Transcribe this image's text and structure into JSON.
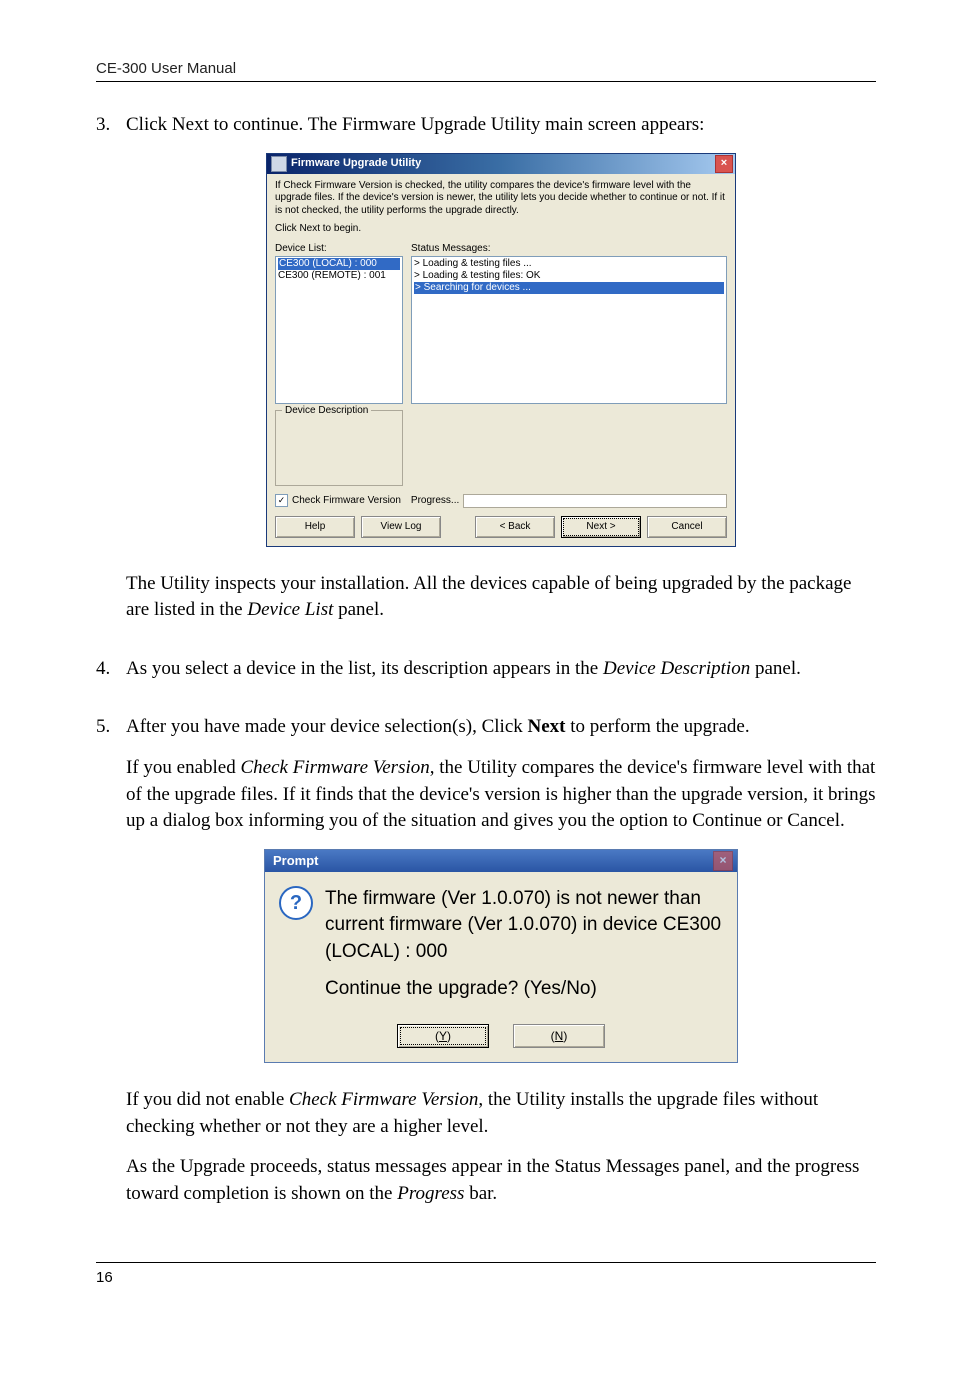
{
  "header": {
    "runhead": "CE-300 User Manual"
  },
  "items": {
    "n3": {
      "num": "3.",
      "lead": "Click Next to continue. The Firmware Upgrade Utility main screen appears:",
      "after1a": "The Utility inspects your installation. All the devices capable of being upgraded by the package are listed in the ",
      "after1b": "Device List",
      "after1c": " panel."
    },
    "n4": {
      "num": "4.",
      "a": "As you select a device in the list, its description appears in the ",
      "b": "Device Description",
      "c": " panel."
    },
    "n5": {
      "num": "5.",
      "a": "After you have made your device selection(s), Click ",
      "b": "Next",
      "c": " to perform the upgrade.",
      "p2a": "If you enabled ",
      "p2b": "Check Firmware Version",
      "p2c": ", the Utility compares the device's firmware level with that of the upgrade files. If it finds that the device's version is higher than the upgrade version, it brings up a dialog box informing you of the situation and gives you the option to Continue or Cancel.",
      "p3a": "If you did not enable ",
      "p3b": "Check Firmware Version",
      "p3c": ", the Utility installs the upgrade files without checking whether or not they are a higher level.",
      "p4a": "As the Upgrade proceeds, status messages appear in the Status Messages panel, and the progress toward completion is shown on the ",
      "p4b": "Progress",
      "p4c": " bar."
    }
  },
  "win": {
    "title": "Firmware Upgrade Utility",
    "close": "×",
    "instr": "If Check Firmware Version is checked, the utility compares the device's firmware level with the upgrade files. If the device's version is newer, the utility lets you decide whether to continue or not. If it is not checked, the utility performs the upgrade directly.",
    "click_next": "Click Next to begin.",
    "dev_list_label": "Device List:",
    "status_label": "Status Messages:",
    "dev0": "CE300 (LOCAL) : 000",
    "dev1": "CE300 (REMOTE) : 001",
    "sm0": "> Loading & testing files ...",
    "sm1": "> Loading & testing files: OK",
    "sm2": "> Searching for devices ...",
    "desc_legend": "Device Description",
    "check_fw": "Check Firmware Version",
    "progress": "Progress...",
    "help": "Help",
    "viewlog": "View Log",
    "back": "< Back",
    "next": "Next >",
    "cancel": "Cancel",
    "checkmark": "✓"
  },
  "dlg": {
    "title": "Prompt",
    "close": "×",
    "qmark": "?",
    "line1": "The firmware (Ver 1.0.070) is not newer than current firmware (Ver 1.0.070) in device CE300 (LOCAL) : 000",
    "line2": "Continue the upgrade? (Yes/No)",
    "yes_pre": "(",
    "yes_u": "Y",
    "yes_post": ")",
    "no_pre": "(",
    "no_u": "N",
    "no_post": ")"
  },
  "footer": {
    "page": "16"
  }
}
